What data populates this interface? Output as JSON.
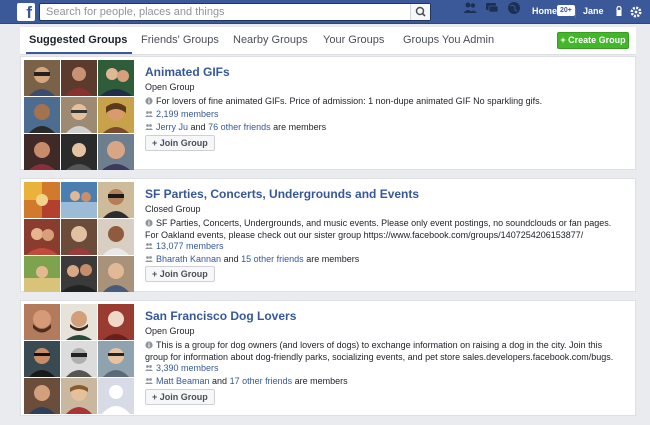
{
  "header": {
    "logo": "f",
    "search_placeholder": "Search for people, places and things",
    "home_label": "Home",
    "home_badge": "20+",
    "user_name": "Jane"
  },
  "tabs": [
    {
      "label": "Suggested Groups",
      "active": true
    },
    {
      "label": "Friends' Groups",
      "active": false
    },
    {
      "label": "Nearby Groups",
      "active": false
    },
    {
      "label": "Your Groups",
      "active": false
    },
    {
      "label": "Groups You Admin",
      "active": false
    }
  ],
  "create_group_label": "+ Create Group",
  "groups": [
    {
      "name": "Animated GIFs",
      "type": "Open Group",
      "description": "For lovers of fine animated GIFs. Price of admission: 1 non-dupe animated GIF No sparkling gifs.",
      "members": "2,199 members",
      "friend_name": "Jerry Ju",
      "and_text": "and",
      "other_friends": "76 other friends",
      "are_members": "are members",
      "join_label": "+ Join Group"
    },
    {
      "name": "SF Parties, Concerts, Undergrounds and Events",
      "type": "Closed Group",
      "description": "SF Parties, Concerts, Undergrounds, and music events. Please only event postings, no soundclouds or fan pages. For Oakland events, please check out our sister group https://www.facebook.com/groups/1407254206153877/",
      "members": "13,077 members",
      "friend_name": "Bharath Kannan",
      "and_text": "and",
      "other_friends": "15 other friends",
      "are_members": "are members",
      "join_label": "+ Join Group"
    },
    {
      "name": "San Francisco Dog Lovers",
      "type": "Open Group",
      "description": "This is a group for dog owners (and lovers of dogs) to exchange information on raising a dog in the city. Join this group for information about dog-friendly parks, socializing events, and pet store sales.developers.facebook.com/bugs.",
      "members": "3,390 members",
      "friend_name": "Matt Beaman",
      "and_text": "and",
      "other_friends": "17 other friends",
      "are_members": "are members",
      "join_label": "+ Join Group"
    }
  ],
  "colors": {
    "brand": "#3b5998",
    "link": "#365899",
    "create_button": "#42b72a"
  }
}
